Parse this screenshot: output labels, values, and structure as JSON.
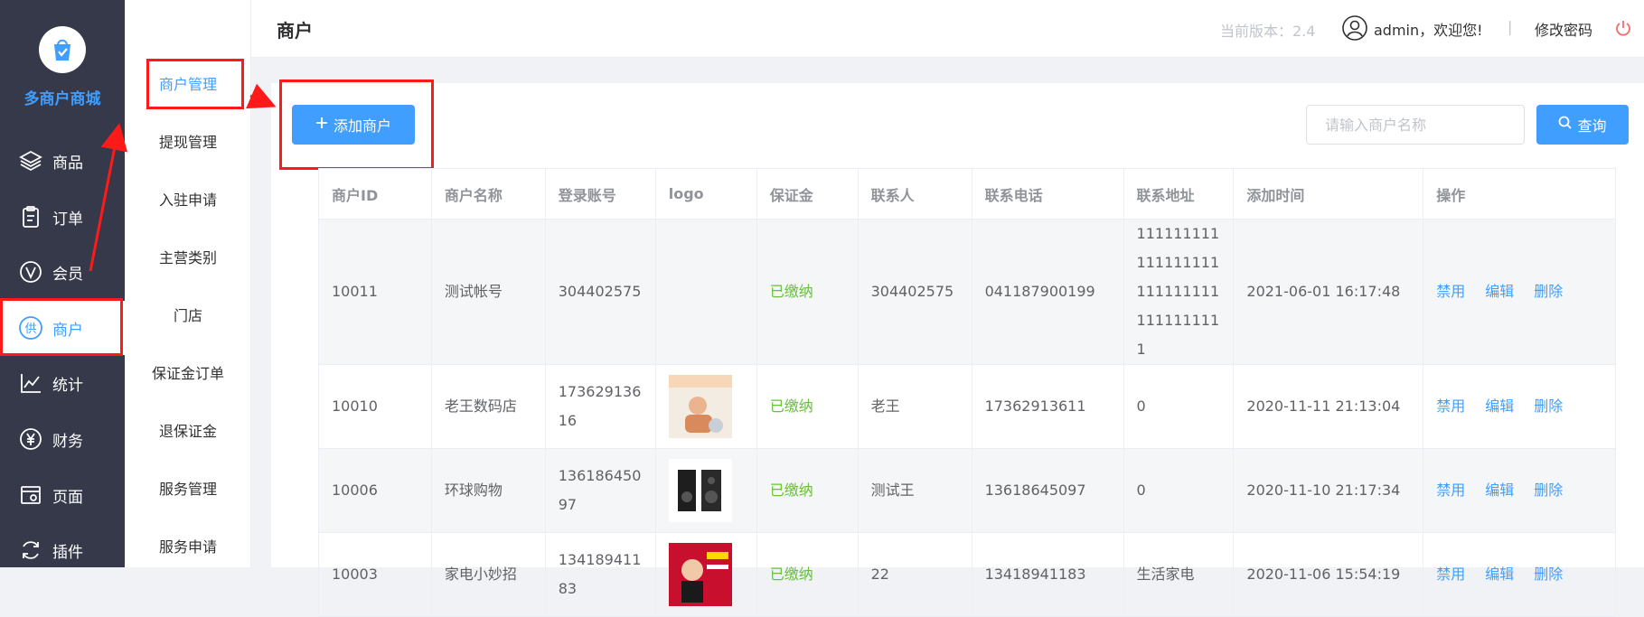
{
  "sidebar": {
    "brand": "多商户商城",
    "items": [
      {
        "label": "商品",
        "icon": "layers-icon"
      },
      {
        "label": "订单",
        "icon": "clipboard-icon"
      },
      {
        "label": "会员",
        "icon": "v-circle-icon"
      },
      {
        "label": "商户",
        "icon": "gong-circle-icon"
      },
      {
        "label": "统计",
        "icon": "line-chart-icon"
      },
      {
        "label": "财务",
        "icon": "yen-circle-icon"
      },
      {
        "label": "页面",
        "icon": "page-gear-icon"
      },
      {
        "label": "插件",
        "icon": "refresh-icon"
      }
    ]
  },
  "submenu": {
    "items": [
      "商户管理",
      "提现管理",
      "入驻申请",
      "主营类别",
      "门店",
      "保证金订单",
      "退保证金",
      "服务管理",
      "服务申请"
    ]
  },
  "header": {
    "title": "商户",
    "version": "当前版本：2.4",
    "user": "admin，欢迎您!",
    "separator": "|",
    "change_password": "修改密码"
  },
  "toolbar": {
    "add_label": "添加商户",
    "search_placeholder": "请输入商户名称",
    "query_label": "查询"
  },
  "table": {
    "columns": [
      "商户ID",
      "商户名称",
      "登录账号",
      "logo",
      "保证金",
      "联系人",
      "联系电话",
      "联系地址",
      "添加时间",
      "操作"
    ],
    "rows": [
      {
        "id": "10011",
        "name": "测试帐号",
        "account": "304402575",
        "deposit": "已缴纳",
        "contact": "304402575",
        "phone": "041187900199",
        "address": "1111111111111111111111111111111111111",
        "time": "2021-06-01 16:17:48"
      },
      {
        "id": "10010",
        "name": "老王数码店",
        "account": "17362913616",
        "deposit": "已缴纳",
        "contact": "老王",
        "phone": "17362913611",
        "address": "0",
        "time": "2020-11-11 21:13:04"
      },
      {
        "id": "10006",
        "name": "环球购物",
        "account": "13618645097",
        "deposit": "已缴纳",
        "contact": "测试王",
        "phone": "13618645097",
        "address": "0",
        "time": "2020-11-10 21:17:34"
      },
      {
        "id": "10003",
        "name": "家电小妙招",
        "account": "13418941183",
        "deposit": "已缴纳",
        "contact": "22",
        "phone": "13418941183",
        "address": "生活家电",
        "time": "2020-11-06 15:54:19"
      }
    ],
    "actions": {
      "disable": "禁用",
      "edit": "编辑",
      "delete": "删除"
    }
  },
  "colors": {
    "accent": "#409eff",
    "sidebar_bg": "#35394a",
    "highlight_box": "#ff1a1a",
    "paid": "#67c23a"
  }
}
